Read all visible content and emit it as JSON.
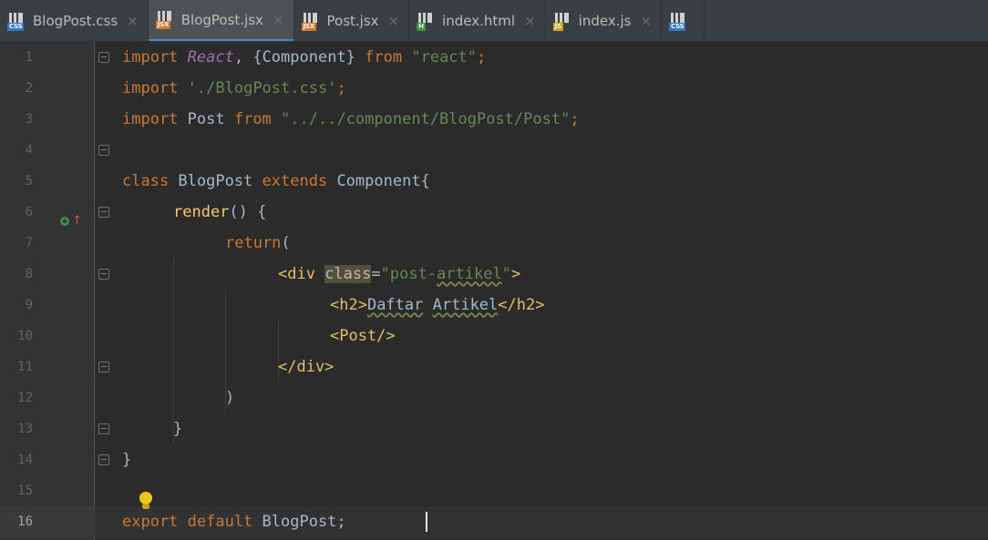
{
  "tabs": [
    {
      "name": "BlogPost.css",
      "badge": "CSS",
      "badge_color": "#2f78c4",
      "active": false
    },
    {
      "name": "BlogPost.jsx",
      "badge": "JSX",
      "badge_color": "#d8762a",
      "active": true
    },
    {
      "name": "Post.jsx",
      "badge": "JSX",
      "badge_color": "#d8762a",
      "active": false
    },
    {
      "name": "index.html",
      "badge": "H",
      "badge_color": "#3f8f3f",
      "active": false
    },
    {
      "name": "index.js",
      "badge": "JS",
      "badge_color": "#c9a21d",
      "active": false
    },
    {
      "name": "",
      "badge": "CSS",
      "badge_color": "#2f78c4",
      "active": false
    }
  ],
  "tab_close_glyph": "×",
  "line_numbers": [
    "1",
    "2",
    "3",
    "4",
    "5",
    "6",
    "7",
    "8",
    "9",
    "10",
    "11",
    "12",
    "13",
    "14",
    "15",
    "16"
  ],
  "current_line": "16",
  "code": {
    "l1": {
      "import": "import",
      "react": "React",
      "open": ", {Component} ",
      "from": "from",
      "mod": "\"react\"",
      "semi": ";"
    },
    "l2": {
      "import": "import",
      "str": "'./BlogPost.css'",
      "semi": ";"
    },
    "l3": {
      "import": "import",
      "name": " Post ",
      "from": "from",
      "str": "\"../../component/BlogPost/Post\"",
      "semi": ";"
    },
    "l5": {
      "class": "class",
      "name": " BlogPost ",
      "extends": "extends",
      "base": " Component{"
    },
    "l6": {
      "fn": "render",
      "rest": "() {"
    },
    "l7": {
      "kw": "return",
      "rest": "("
    },
    "l8": {
      "open": "<div ",
      "attr": "class",
      "eq": "=",
      "q1": "\"post-",
      "typo": "artikel",
      "q2": "\"",
      "close": ">"
    },
    "l9": {
      "open": "<h2>",
      "w1": "Daftar",
      "sp": " ",
      "w2": "Artikel",
      "close": "</h2>"
    },
    "l10": {
      "tag": "<Post/>"
    },
    "l11": {
      "tag": "</div>"
    },
    "l12": {
      "text": ")"
    },
    "l13": {
      "text": "}"
    },
    "l14": {
      "text": "}"
    },
    "l16": {
      "export": "export default",
      "name": " BlogPost;"
    }
  },
  "colors": {
    "keyword": "#cc7832",
    "string": "#6a8759",
    "class_ref": "#9876aa",
    "function": "#ffc66d",
    "tag": "#e8bf6a",
    "background": "#2b2b2b"
  },
  "icons": [
    "css-file-icon",
    "jsx-file-icon",
    "html-file-icon",
    "js-file-icon",
    "lightbulb-icon",
    "implements-override-icon",
    "fold-marker-icon"
  ]
}
